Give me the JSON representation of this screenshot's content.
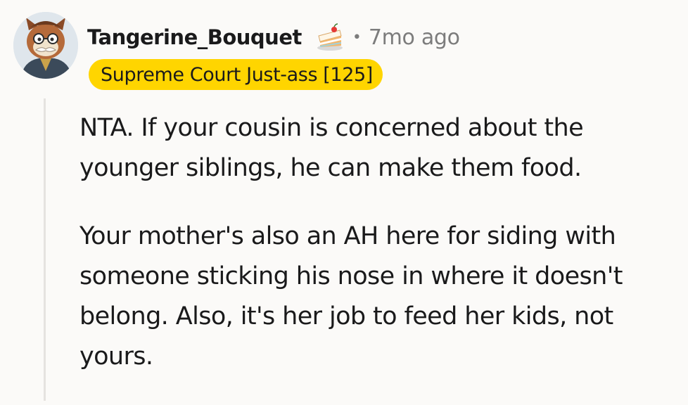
{
  "comment": {
    "author": "Tangerine_Bouquet",
    "separator": "•",
    "timestamp": "7mo ago",
    "flair": "Supreme Court Just-ass [125]",
    "flair_color": "#ffd500",
    "avatar_icon": "avatar-image",
    "cake_icon": "cake-day-icon",
    "paragraphs": [
      "NTA. If your cousin is concerned about the younger siblings, he can make them food.",
      "Your mother's also an AH here for siding with someone sticking his nose in where it doesn't belong. Also, it's her job to feed her kids, not yours."
    ]
  }
}
